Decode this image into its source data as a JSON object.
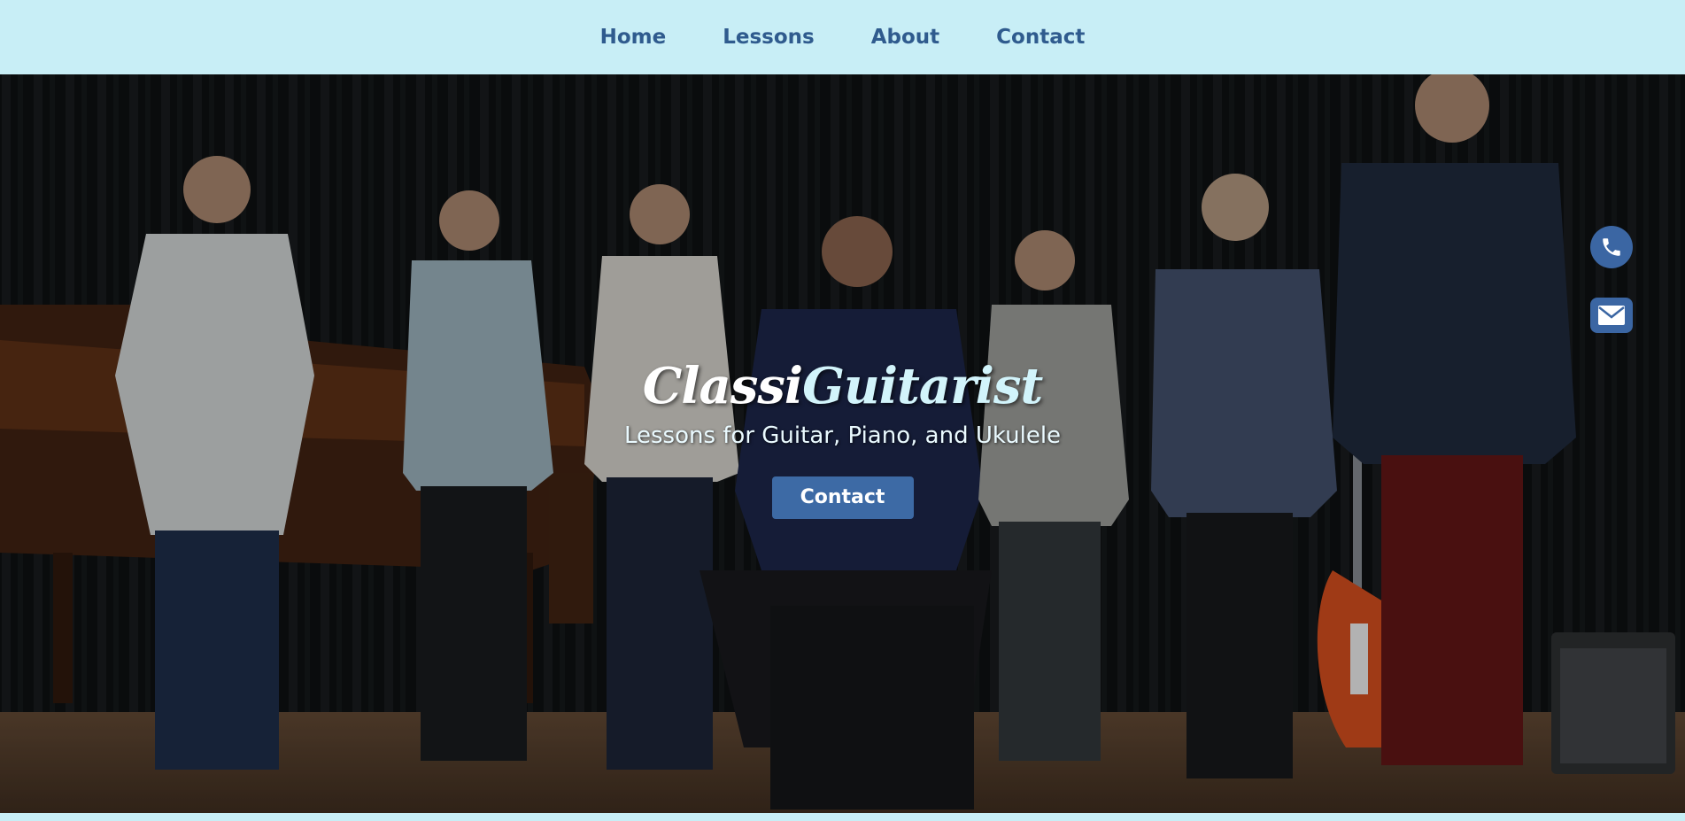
{
  "nav": {
    "items": [
      {
        "label": "Home"
      },
      {
        "label": "Lessons"
      },
      {
        "label": "About"
      },
      {
        "label": "Contact"
      }
    ]
  },
  "hero": {
    "brand_part1": "Classi",
    "brand_part2": "Guitarist",
    "subtitle": "Lessons for Guitar, Piano, and Ukulele",
    "cta_label": "Contact",
    "background_image": "group-photo-of-students-with-teacher-on-stage"
  },
  "floating_actions": {
    "phone_icon": "phone-icon",
    "mail_icon": "envelope-icon"
  },
  "colors": {
    "nav_bg": "#c8eef6",
    "nav_link": "#2f5b8e",
    "button": "#3d6aa5",
    "floating": "#3b66a3"
  }
}
